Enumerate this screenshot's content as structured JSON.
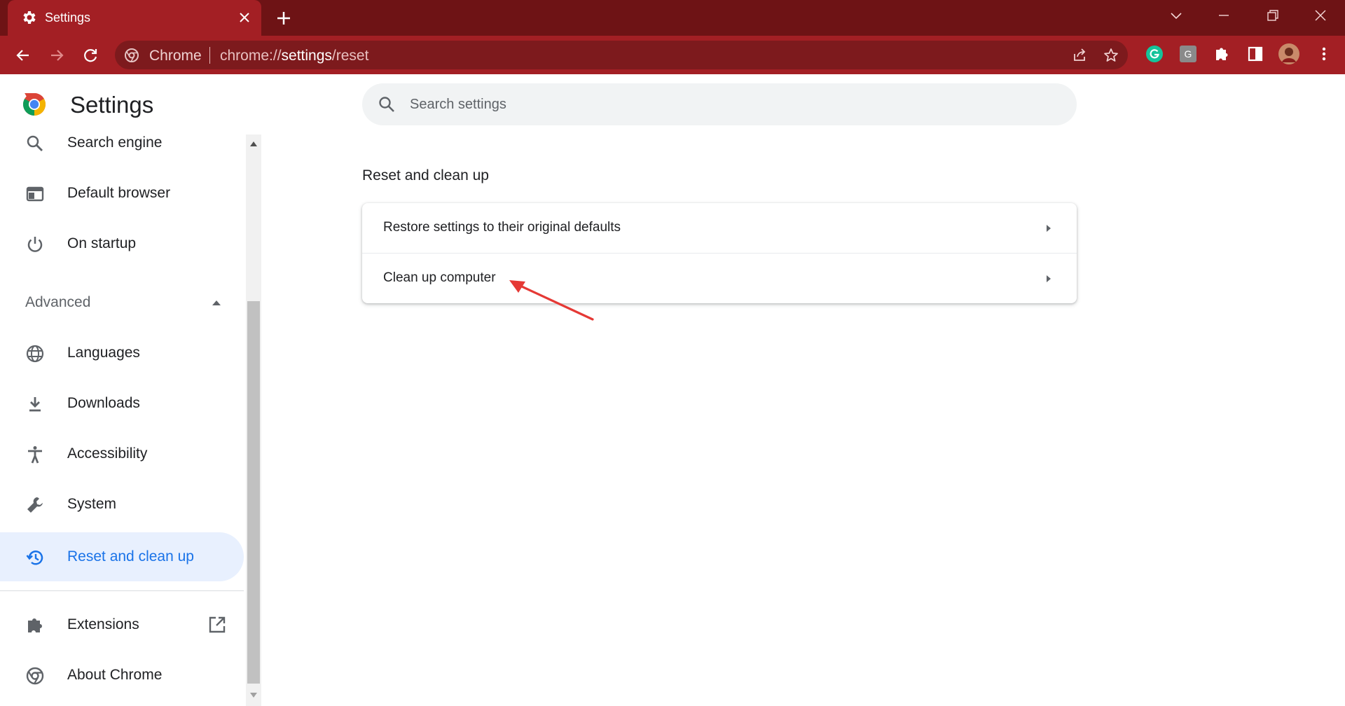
{
  "browser": {
    "tab_title": "Settings",
    "omnibox_chip": "Chrome",
    "url_prefix": "chrome://",
    "url_host": "settings",
    "url_path": "/reset",
    "frame_color": "#6e1315",
    "toolbar_color": "#a31f24"
  },
  "header": {
    "title": "Settings",
    "search_placeholder": "Search settings"
  },
  "sidebar": {
    "items": [
      {
        "label": "Search engine",
        "icon": "search-icon"
      },
      {
        "label": "Default browser",
        "icon": "browser-window-icon"
      },
      {
        "label": "On startup",
        "icon": "power-icon"
      }
    ],
    "advanced_label": "Advanced",
    "advanced_items": [
      {
        "label": "Languages",
        "icon": "globe-icon"
      },
      {
        "label": "Downloads",
        "icon": "download-icon"
      },
      {
        "label": "Accessibility",
        "icon": "accessibility-icon"
      },
      {
        "label": "System",
        "icon": "wrench-icon"
      },
      {
        "label": "Reset and clean up",
        "icon": "restore-icon",
        "active": true
      }
    ],
    "footer_items": [
      {
        "label": "Extensions",
        "icon": "puzzle-icon"
      },
      {
        "label": "About Chrome",
        "icon": "chrome-icon"
      }
    ],
    "active_color": "#1a73e8"
  },
  "main": {
    "section_title": "Reset and clean up",
    "rows": [
      {
        "label": "Restore settings to their original defaults"
      },
      {
        "label": "Clean up computer"
      }
    ],
    "annotation_color": "#e53935"
  }
}
